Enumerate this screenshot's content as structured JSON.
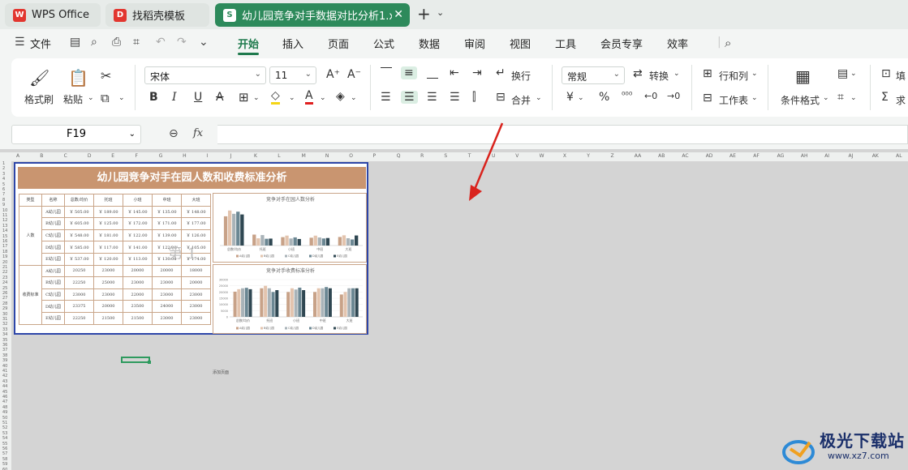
{
  "tabs": {
    "wps": "WPS Office",
    "daoke": "找稻壳模板",
    "file": "幼儿园竞争对手数据对比分析1.xlsx"
  },
  "menu": {
    "file_label": "文件",
    "items": [
      "开始",
      "插入",
      "页面",
      "公式",
      "数据",
      "审阅",
      "视图",
      "工具",
      "会员专享",
      "效率"
    ]
  },
  "ribbon": {
    "format_painter": "格式刷",
    "paste": "粘贴",
    "font_name": "宋体",
    "font_size": "11",
    "wrap": "换行",
    "merge": "合并",
    "number_format": "常规",
    "convert": "转换",
    "row_col": "行和列",
    "worksheet": "工作表",
    "cond_format": "条件格式",
    "fill": "填",
    "sum": "求"
  },
  "formula_bar": {
    "cell_ref": "F19",
    "fx": "fx"
  },
  "sheet": {
    "columns": [
      "A",
      "B",
      "C",
      "D",
      "E",
      "F",
      "G",
      "H",
      "I",
      "J",
      "K",
      "L",
      "M",
      "N",
      "O",
      "P",
      "Q",
      "R",
      "S",
      "T",
      "U",
      "V",
      "W",
      "X",
      "Y",
      "Z",
      "AA",
      "AB",
      "AC",
      "AD",
      "AE",
      "AF",
      "AG",
      "AH",
      "AI",
      "AJ",
      "AK",
      "AL"
    ],
    "rows": [
      "1",
      "2",
      "3",
      "4",
      "5",
      "6",
      "7",
      "8",
      "9",
      "10",
      "11",
      "12",
      "13",
      "14",
      "15",
      "16",
      "17",
      "18",
      "19",
      "20",
      "21",
      "22",
      "23",
      "24",
      "25",
      "26",
      "27",
      "28",
      "29",
      "30",
      "31",
      "32",
      "33",
      "34",
      "35",
      "36",
      "37",
      "38",
      "39",
      "40",
      "41",
      "42",
      "43",
      "44",
      "45",
      "46",
      "47",
      "48",
      "49",
      "50",
      "51",
      "52",
      "53",
      "54",
      "55",
      "56",
      "57",
      "58",
      "59",
      "60"
    ],
    "title": "幼儿园竞争对手在园人数和收费标准分析",
    "header": [
      "类型",
      "名称",
      "总数/均价",
      "托班",
      "小班",
      "中班",
      "大班"
    ],
    "group1_label": "人数",
    "group2_label": "收费标准",
    "group1_rows": [
      [
        "A幼儿园",
        "￥ 505.00",
        "￥ 189.00",
        "￥ 145.00",
        "￥ 135.00",
        "￥ 148.00"
      ],
      [
        "B幼儿园",
        "￥ 605.00",
        "￥ 125.00",
        "￥ 172.00",
        "￥ 171.00",
        "￥ 177.00"
      ],
      [
        "C幼儿园",
        "￥ 548.00",
        "￥ 181.00",
        "￥ 122.00",
        "￥ 139.00",
        "￥ 126.00"
      ],
      [
        "D幼儿园",
        "￥ 585.00",
        "￥ 117.00",
        "￥ 141.00",
        "￥ 122.00",
        "￥ 105.00"
      ],
      [
        "E幼儿园",
        "￥ 537.00",
        "￥ 120.00",
        "￥ 113.00",
        "￥ 130.00",
        "￥ 174.00"
      ]
    ],
    "group2_rows": [
      [
        "A幼儿园",
        "20250",
        "23000",
        "20000",
        "20000",
        "18000"
      ],
      [
        "B幼儿园",
        "22250",
        "25000",
        "23000",
        "23000",
        "20000"
      ],
      [
        "C幼儿园",
        "23000",
        "23000",
        "22000",
        "23000",
        "23000"
      ],
      [
        "D幼儿园",
        "23375",
        "20000",
        "23500",
        "24000",
        "23000"
      ],
      [
        "E幼儿园",
        "22250",
        "21500",
        "21500",
        "23000",
        "23000"
      ]
    ],
    "watermark": "第 1",
    "add_page": "添加页面"
  },
  "chart_data": [
    {
      "type": "bar",
      "title": "竞争对手在园人数分析",
      "categories": [
        "总数/均价",
        "托班",
        "小班",
        "中班",
        "大班"
      ],
      "series": [
        {
          "name": "A幼儿园",
          "values": [
            505,
            189,
            145,
            135,
            148
          ]
        },
        {
          "name": "B幼儿园",
          "values": [
            605,
            125,
            172,
            171,
            177
          ]
        },
        {
          "name": "C幼儿园",
          "values": [
            548,
            181,
            122,
            139,
            126
          ]
        },
        {
          "name": "D幼儿园",
          "values": [
            585,
            117,
            141,
            122,
            105
          ]
        },
        {
          "name": "E幼儿园",
          "values": [
            537,
            120,
            113,
            130,
            174
          ]
        }
      ],
      "ylim": [
        0,
        700
      ],
      "legend": "bottom"
    },
    {
      "type": "bar",
      "title": "竞争对手收费标准分析",
      "categories": [
        "总数/均价",
        "托班",
        "小班",
        "中班",
        "大班"
      ],
      "series": [
        {
          "name": "A幼儿园",
          "values": [
            20250,
            23000,
            20000,
            20000,
            18000
          ]
        },
        {
          "name": "B幼儿园",
          "values": [
            22250,
            25000,
            23000,
            23000,
            20000
          ]
        },
        {
          "name": "C幼儿园",
          "values": [
            23000,
            23000,
            22000,
            23000,
            23000
          ]
        },
        {
          "name": "D幼儿园",
          "values": [
            23375,
            20000,
            23500,
            24000,
            23000
          ]
        },
        {
          "name": "E幼儿园",
          "values": [
            22250,
            21500,
            21500,
            23000,
            23000
          ]
        }
      ],
      "yticks": [
        "30000",
        "25000",
        "20000",
        "15000",
        "10000",
        "5000",
        "0"
      ],
      "ylim": [
        0,
        30000
      ],
      "legend": "bottom"
    }
  ],
  "series_colors": [
    "#c8a288",
    "#e3c4ae",
    "#a9b3b8",
    "#6b8793",
    "#2f4752"
  ],
  "watermark_site": {
    "name": "极光下载站",
    "url": "www.xz7.com"
  }
}
